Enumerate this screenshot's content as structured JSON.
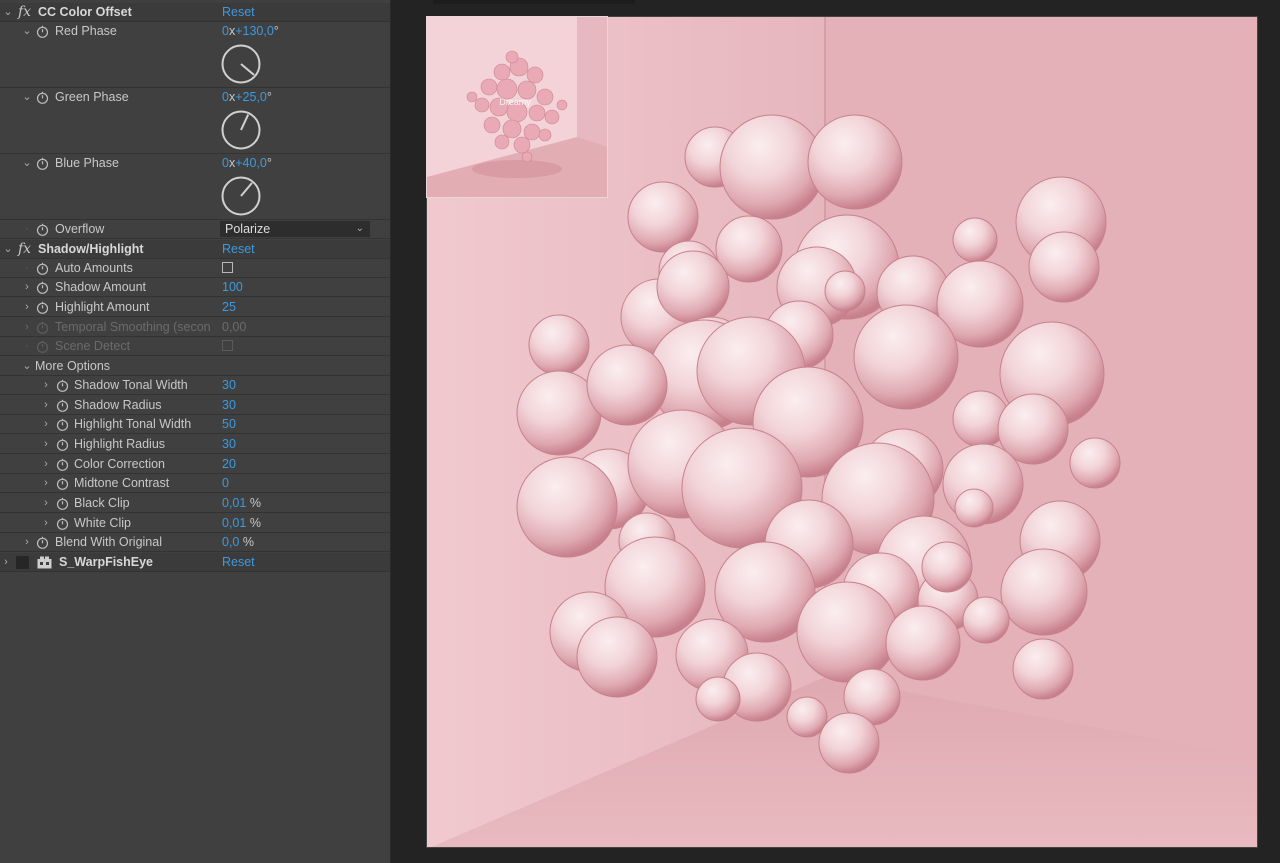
{
  "effects": {
    "color_offset": {
      "name": "CC Color Offset",
      "reset": "Reset",
      "red_phase": {
        "label": "Red Phase",
        "rev": "0",
        "x": "x",
        "deg": "+130,0",
        "unit": "°",
        "angle": 130
      },
      "green_phase": {
        "label": "Green Phase",
        "rev": "0",
        "x": "x",
        "deg": "+25,0",
        "unit": "°",
        "angle": 25
      },
      "blue_phase": {
        "label": "Blue Phase",
        "rev": "0",
        "x": "x",
        "deg": "+40,0",
        "unit": "°",
        "angle": 40
      },
      "overflow": {
        "label": "Overflow",
        "value": "Polarize"
      }
    },
    "shadow_highlight": {
      "name": "Shadow/Highlight",
      "reset": "Reset",
      "auto_amounts": {
        "label": "Auto Amounts"
      },
      "shadow_amount": {
        "label": "Shadow Amount",
        "value": "100"
      },
      "highlight_amount": {
        "label": "Highlight Amount",
        "value": "25"
      },
      "temporal_smoothing": {
        "label": "Temporal Smoothing (secon",
        "value": "0,00"
      },
      "scene_detect": {
        "label": "Scene Detect"
      },
      "more_options": {
        "label": "More Options"
      },
      "shadow_tonal_width": {
        "label": "Shadow Tonal Width",
        "value": "30"
      },
      "shadow_radius": {
        "label": "Shadow Radius",
        "value": "30"
      },
      "highlight_tonal_width": {
        "label": "Highlight Tonal Width",
        "value": "50"
      },
      "highlight_radius": {
        "label": "Highlight Radius",
        "value": "30"
      },
      "color_correction": {
        "label": "Color Correction",
        "value": "20"
      },
      "midtone_contrast": {
        "label": "Midtone Contrast",
        "value": "0"
      },
      "black_clip": {
        "label": "Black Clip",
        "value": "0,01",
        "unit": "%"
      },
      "white_clip": {
        "label": "White Clip",
        "value": "0,01",
        "unit": "%"
      },
      "blend_with_original": {
        "label": "Blend With Original",
        "value": "0,0",
        "unit": "%"
      }
    },
    "warp_fisheye": {
      "name": "S_WarpFishEye",
      "reset": "Reset"
    }
  },
  "viewer": {
    "thumbnail_caption": "Dreamy"
  },
  "colors": {
    "accent": "#3b9ae1",
    "panel_bg": "#404040",
    "canvas_bg": "#e6b9bf"
  }
}
